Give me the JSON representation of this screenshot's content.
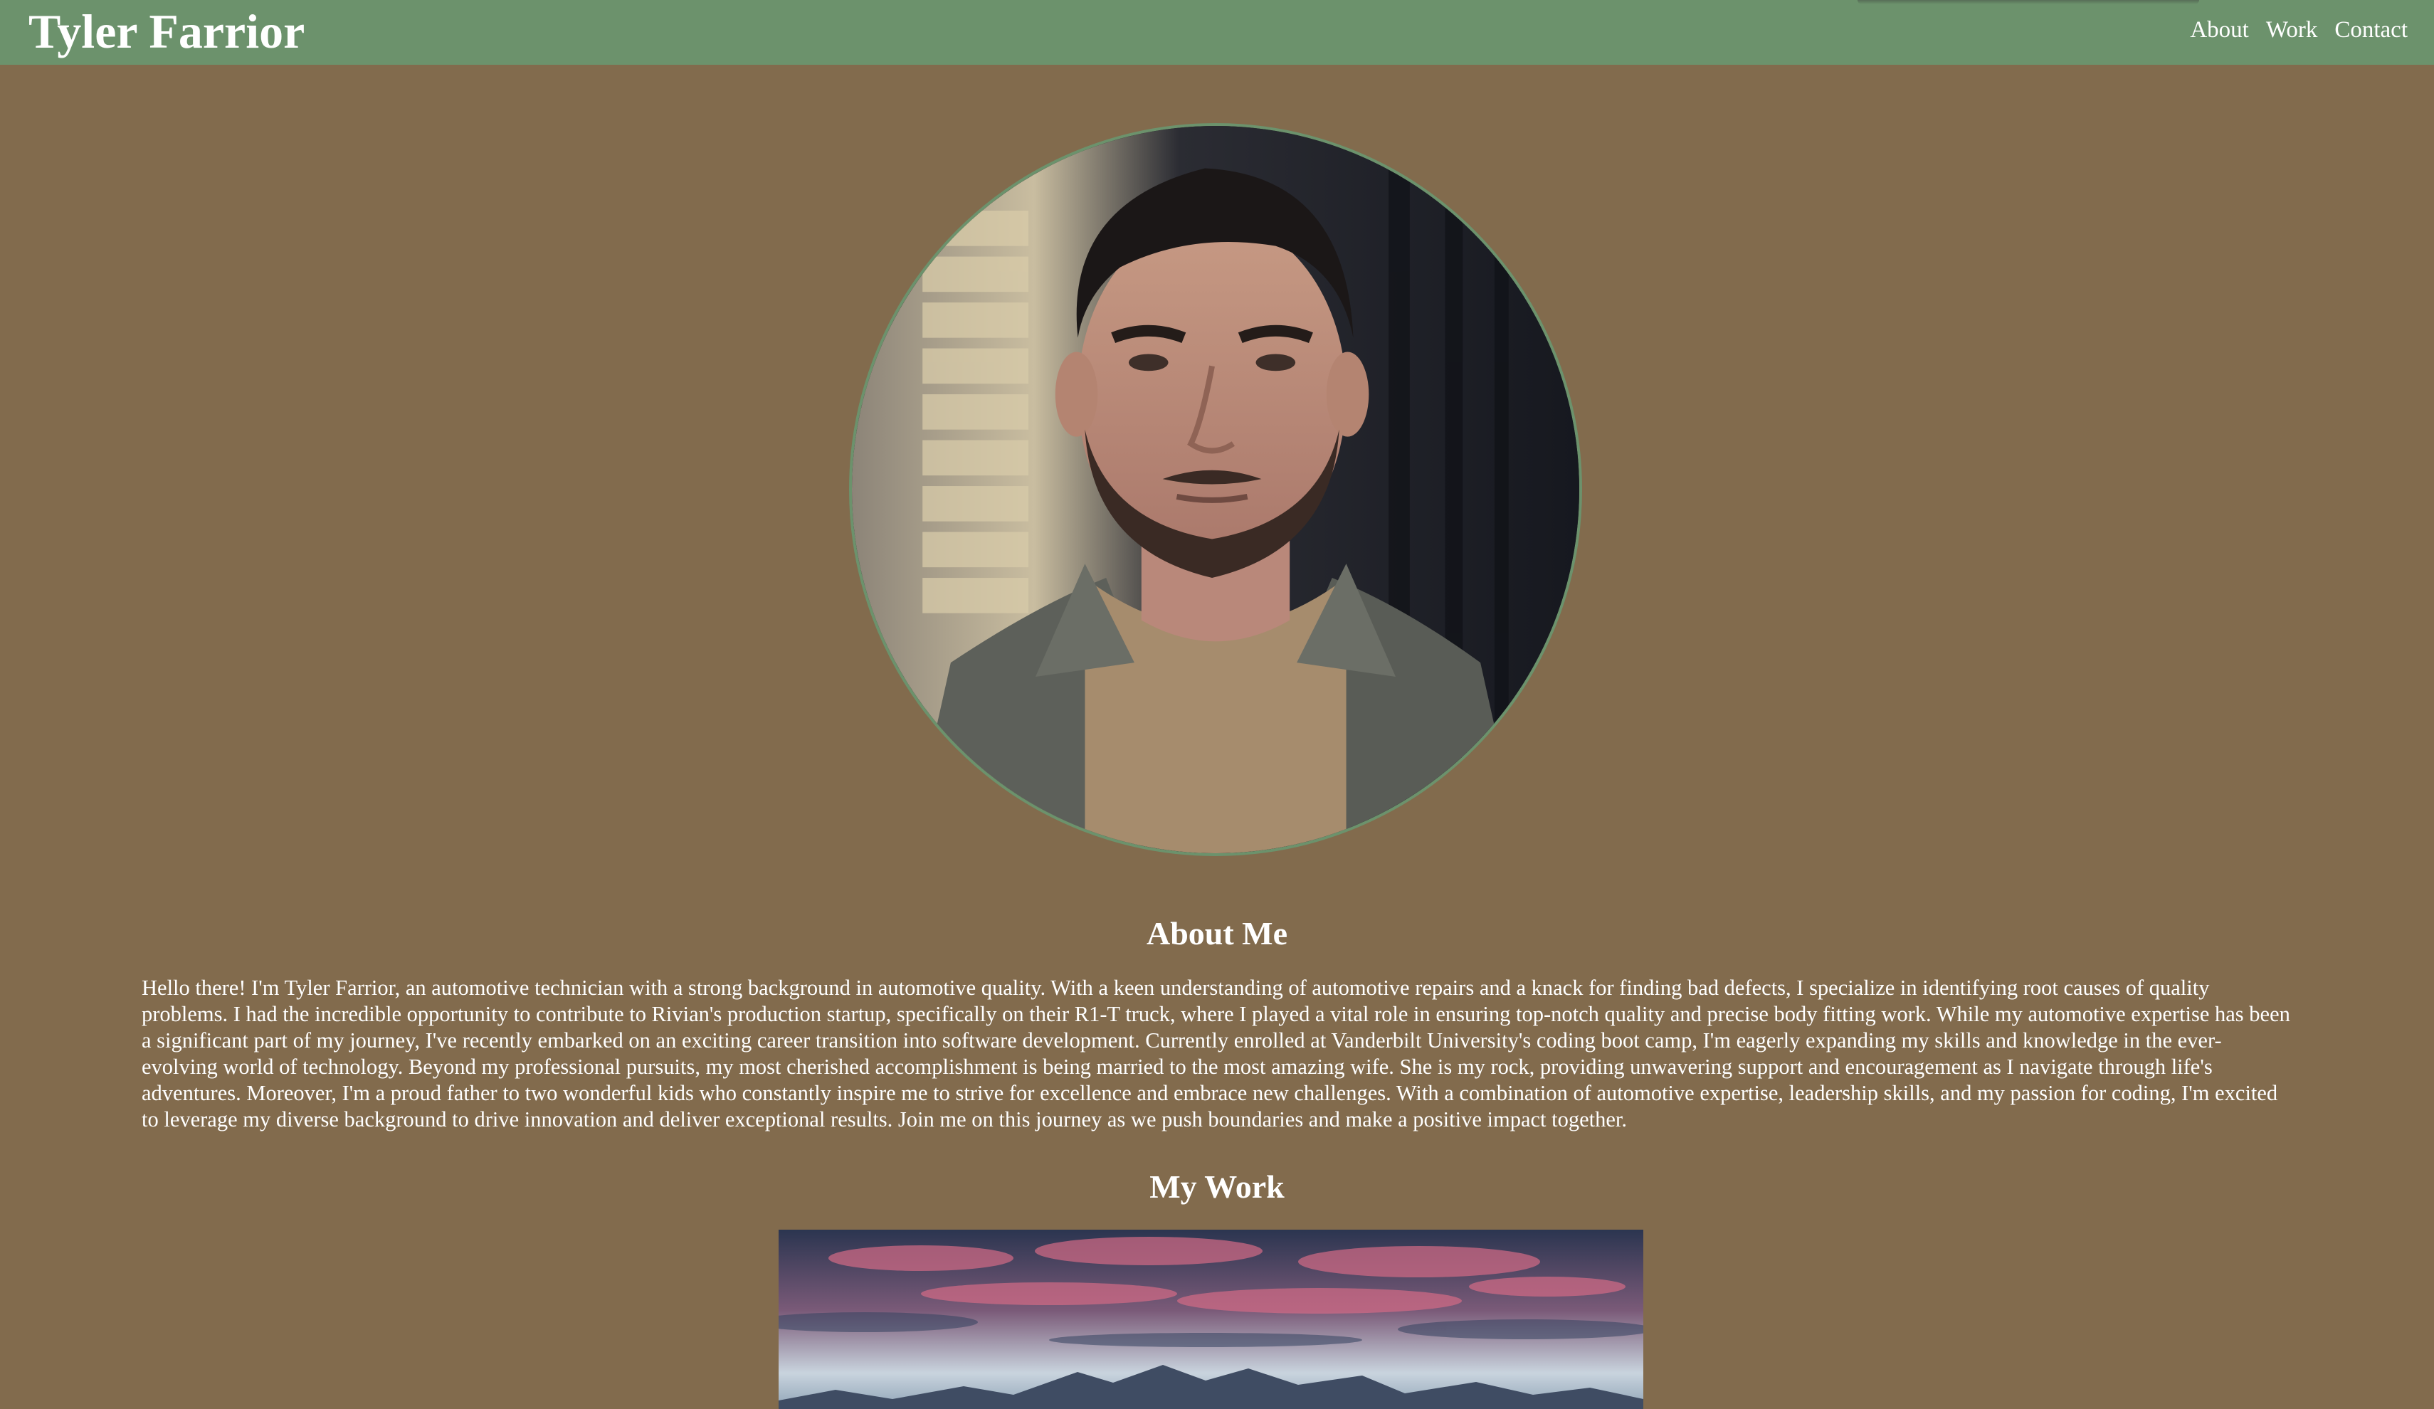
{
  "header": {
    "title": "Tyler Farrior",
    "nav": [
      {
        "label": "About"
      },
      {
        "label": "Work"
      },
      {
        "label": "Contact"
      }
    ],
    "background_color": "#6c926c"
  },
  "page": {
    "background_color": "#826b4d"
  },
  "profile_photo": {
    "icon": "portrait-photo"
  },
  "about": {
    "heading": "About Me",
    "text": "Hello there! I'm Tyler Farrior, an automotive technician with a strong background in automotive quality. With a keen understanding of automotive repairs and a knack for finding bad defects, I specialize in identifying root causes of quality problems. I had the incredible opportunity to contribute to Rivian's production startup, specifically on their R1-T truck, where I played a vital role in ensuring top-notch quality and precise body fitting work. While my automotive expertise has been a significant part of my journey, I've recently embarked on an exciting career transition into software development. Currently enrolled at Vanderbilt University's coding boot camp, I'm eagerly expanding my skills and knowledge in the ever-evolving world of technology. Beyond my professional pursuits, my most cherished accomplishment is being married to the most amazing wife. She is my rock, providing unwavering support and encouragement as I navigate through life's adventures. Moreover, I'm a proud father to two wonderful kids who constantly inspire me to strive for excellence and embrace new challenges. With a combination of automotive expertise, leadership skills, and my passion for coding, I'm excited to leverage my diverse background to drive innovation and deliver exceptional results. Join me on this journey as we push boundaries and make a positive impact together."
  },
  "work": {
    "heading": "My Work",
    "image_icon": "mountain-sunset-image"
  }
}
